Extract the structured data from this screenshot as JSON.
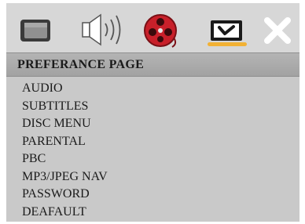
{
  "tabs": [
    {
      "name": "tv-screen-icon",
      "active": false
    },
    {
      "name": "speaker-icon",
      "active": false
    },
    {
      "name": "film-reel-icon",
      "active": false
    },
    {
      "name": "checkbox-icon",
      "active": true
    },
    {
      "name": "exit-x-icon",
      "active": false
    }
  ],
  "page": {
    "title": "PREFERANCE PAGE"
  },
  "menu": {
    "items": [
      "AUDIO",
      "SUBTITLES",
      "DISC MENU",
      "PARENTAL",
      "PBC",
      "MP3/JPEG NAV",
      "PASSWORD",
      "DEAFAULT"
    ]
  },
  "colors": {
    "active_tab_underline": "#f2b134",
    "reel": "#c8202a",
    "menu_background": "#c9c9c9",
    "title_bar": "#a8a8a8"
  }
}
